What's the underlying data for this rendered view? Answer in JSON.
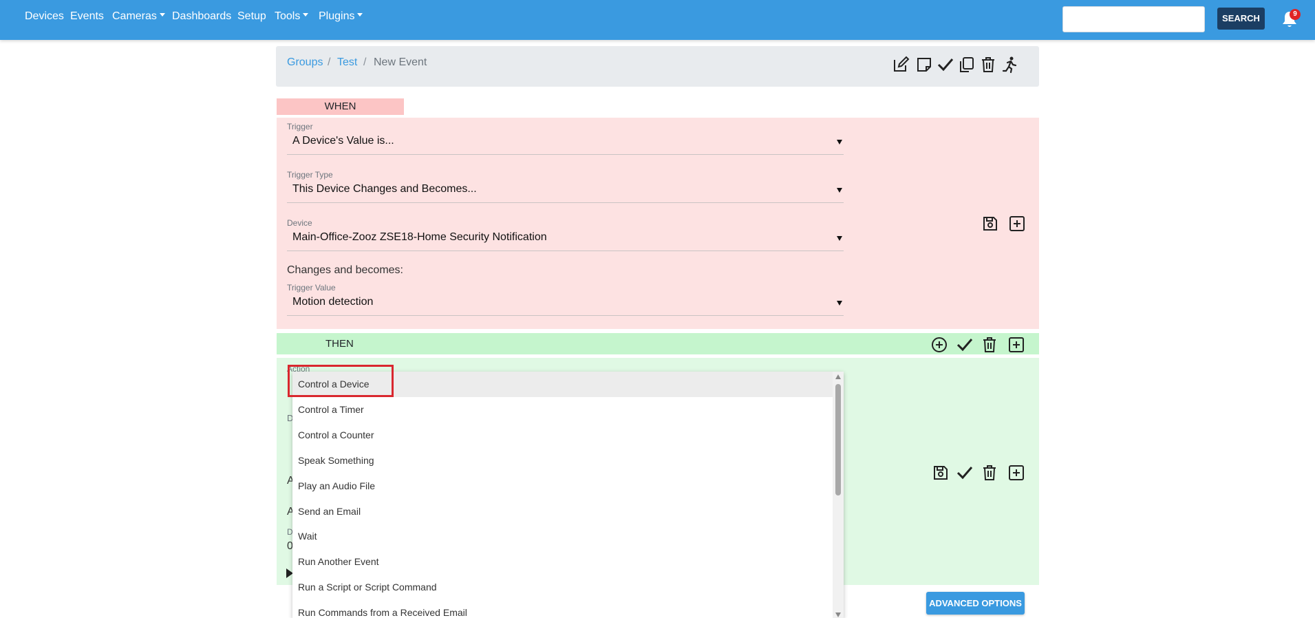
{
  "nav": {
    "items": [
      "Devices",
      "Events",
      "Cameras",
      "Dashboards",
      "Setup",
      "Tools",
      "Plugins"
    ],
    "search_button": "SEARCH",
    "notification_count": "9",
    "colors": {
      "bar": "#3a9ae0",
      "search_button": "#1b3e63",
      "badge": "#e02424"
    }
  },
  "breadcrumb": {
    "groups": "Groups",
    "separator": "/",
    "test": "Test",
    "current": "New Event"
  },
  "toolbar_icons": [
    "edit-icon",
    "note-icon",
    "check-icon",
    "copy-icon",
    "trash-icon",
    "run-icon"
  ],
  "when": {
    "header": "WHEN",
    "trigger": {
      "label": "Trigger",
      "value": "A Device's Value is..."
    },
    "trigger_type": {
      "label": "Trigger Type",
      "value": "This Device Changes and Becomes..."
    },
    "device": {
      "label": "Device",
      "value": "Main-Office-Zooz ZSE18-Home Security Notification"
    },
    "changes_text": "Changes and becomes:",
    "trigger_value": {
      "label": "Trigger Value",
      "value": "Motion detection"
    },
    "colors": {
      "tab": "#fcc5c5",
      "panel": "#fde2e2"
    }
  },
  "then": {
    "header": "THEN",
    "action_label": "Action",
    "partial_labels": [
      "D",
      "A",
      "A",
      "D",
      "0"
    ],
    "colors": {
      "bar": "#c5f5cd",
      "panel": "#e0f9e4"
    }
  },
  "advanced_options": "ADVANCED OPTIONS",
  "dropdown": {
    "selected": "Control a Device",
    "options": [
      "Control a Device",
      "Control a Timer",
      "Control a Counter",
      "Speak Something",
      "Play an Audio File",
      "Send an Email",
      "Wait",
      "Run Another Event",
      "Run a Script or Script Command",
      "Run Commands from a Received Email"
    ]
  }
}
